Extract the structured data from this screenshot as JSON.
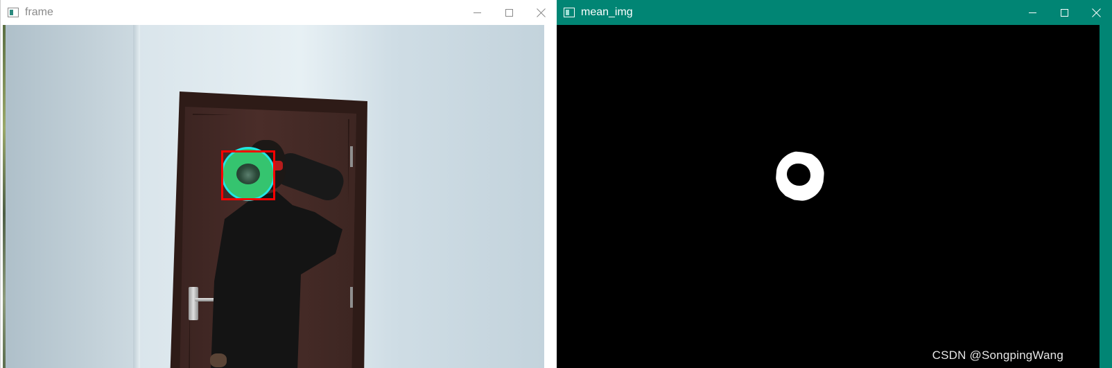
{
  "windows": {
    "frame": {
      "title": "frame",
      "buttons": [
        "minimize",
        "maximize",
        "close"
      ]
    },
    "mean_img": {
      "title": "mean_img",
      "buttons": [
        "minimize",
        "maximize",
        "close"
      ]
    }
  },
  "watermark": "CSDN @SongpingWang",
  "colors": {
    "active_titlebar": "#018574",
    "inactive_titlebar": "#ffffff",
    "track_box": "#ff0000",
    "track_circle": "#22e5e5",
    "marker_fill": "#35c46f"
  },
  "icons": {
    "app": "window-app-icon",
    "minimize": "minimize-icon",
    "maximize": "maximize-icon",
    "close": "close-icon"
  }
}
